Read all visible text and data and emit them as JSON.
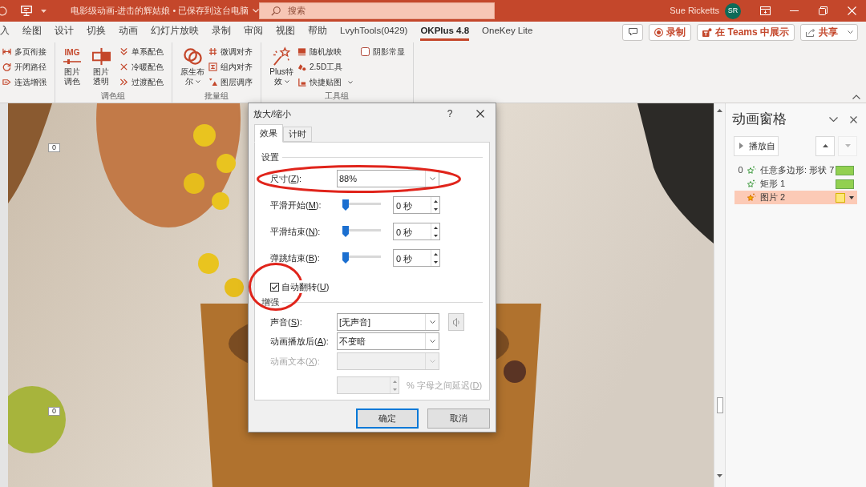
{
  "title_bar": {
    "title": "电影级动画-进击的辉姑娘 • 已保存到这台电脑",
    "user_name": "Sue Ricketts",
    "avatar_initials": "SR"
  },
  "search": {
    "placeholder": "搜索"
  },
  "ribbon_tabs": [
    {
      "label": "入",
      "selected": false
    },
    {
      "label": "绘图",
      "selected": false
    },
    {
      "label": "设计",
      "selected": false
    },
    {
      "label": "切换",
      "selected": false
    },
    {
      "label": "动画",
      "selected": false
    },
    {
      "label": "幻灯片放映",
      "selected": false
    },
    {
      "label": "录制",
      "selected": false
    },
    {
      "label": "审阅",
      "selected": false
    },
    {
      "label": "视图",
      "selected": false
    },
    {
      "label": "帮助",
      "selected": false
    },
    {
      "label": "LvyhTools(0429)",
      "selected": false
    },
    {
      "label": "OKPlus 4.8",
      "selected": true
    },
    {
      "label": "OneKey Lite",
      "selected": false
    }
  ],
  "header_buttons": [
    {
      "kind": "comment"
    },
    {
      "kind": "record",
      "label": "录制"
    },
    {
      "kind": "teams",
      "label": "在 Teams 中展示"
    },
    {
      "kind": "share",
      "label": "共享"
    }
  ],
  "ribbon_groups": [
    {
      "items": [
        {
          "kind": "small",
          "label": "多页衔接"
        },
        {
          "kind": "small",
          "label": "开闭路径"
        },
        {
          "kind": "small",
          "label": "连选增强"
        }
      ]
    },
    {
      "label": "调色组",
      "items": [
        {
          "kind": "large",
          "label": "图片调色",
          "icon_text": "IMG"
        },
        {
          "kind": "large",
          "label": "图片透明"
        },
        {
          "kind": "small",
          "label": "单系配色"
        },
        {
          "kind": "small",
          "label": "冷暖配色"
        },
        {
          "kind": "small",
          "label": "过渡配色"
        }
      ]
    },
    {
      "label": "批量组",
      "items": [
        {
          "kind": "large",
          "label": "原生布尔",
          "dropdown": true
        },
        {
          "kind": "small",
          "label": "微调对齐"
        },
        {
          "kind": "small",
          "label": "组内对齐"
        },
        {
          "kind": "small",
          "label": "图层调序"
        }
      ]
    },
    {
      "label": "工具组",
      "items": [
        {
          "kind": "large",
          "label": "Plus特效",
          "dropdown": true
        },
        {
          "kind": "small",
          "label": "随机放映"
        },
        {
          "kind": "small",
          "label": "2.5D工具"
        },
        {
          "kind": "small",
          "label": "快捷贴图",
          "dropdown": true
        },
        {
          "kind": "checkbox",
          "label": "阴影常显",
          "checked": false
        }
      ]
    }
  ],
  "slide": {
    "order_tags": [
      "0",
      "0"
    ]
  },
  "animation_pane": {
    "title": "动画窗格",
    "play_label": "播放自",
    "move_buttons": [
      {
        "kind": "up",
        "disabled": false
      },
      {
        "kind": "down",
        "disabled": true
      }
    ],
    "items": [
      {
        "order": "0",
        "name": "任意多边形: 形状 7",
        "kind": "entrance",
        "selected": false
      },
      {
        "name": "矩形 1",
        "kind": "entrance",
        "selected": false
      },
      {
        "name": "图片 2",
        "kind": "emphasis",
        "selected": true
      }
    ]
  },
  "dialog": {
    "title": "放大/缩小",
    "help_label": "?",
    "tabs": [
      {
        "label": "效果",
        "selected": true
      },
      {
        "label": "计时",
        "selected": false
      }
    ],
    "sections": [
      {
        "heading": "设置",
        "rows": [
          {
            "kind": "dropdown",
            "label_parts": [
              "尺寸(",
              "Z",
              "):"
            ],
            "value": "88%",
            "disabled": false,
            "circled": true
          },
          {
            "kind": "slider",
            "label_parts": [
              "平滑开始(",
              "M",
              "):"
            ],
            "level": 0,
            "value": "0 秒",
            "disabled": false,
            "circled": false
          },
          {
            "kind": "slider",
            "label_parts": [
              "平滑结束(",
              "N",
              "):"
            ],
            "level": 0,
            "value": "0 秒",
            "disabled": false,
            "circled": false
          },
          {
            "kind": "slider",
            "label_parts": [
              "弹跳结束(",
              "B",
              "):"
            ],
            "level": 0,
            "value": "0 秒",
            "disabled": false,
            "circled": false
          },
          {
            "kind": "checkbox",
            "label_parts": [
              "自动翻转(",
              "U",
              ")"
            ],
            "checked": true,
            "disabled": false,
            "circled": true
          }
        ]
      },
      {
        "heading": "增强",
        "rows": [
          {
            "kind": "sound",
            "label_parts": [
              "声音(",
              "S",
              "):"
            ],
            "value": "[无声音]",
            "disabled": false,
            "circled": false
          },
          {
            "kind": "dropdown",
            "label_parts": [
              "动画播放后(",
              "A",
              "):"
            ],
            "value": "不变暗",
            "disabled": false,
            "circled": false
          },
          {
            "kind": "dropdown",
            "label_parts": [
              "动画文本(",
              "X",
              "):"
            ],
            "disabled": true,
            "circled": false
          },
          {
            "kind": "spinner",
            "suffix_parts": [
              "% 字母之间延迟(",
              "D",
              ")"
            ],
            "disabled": true,
            "circled": false
          }
        ]
      }
    ],
    "buttons": [
      {
        "label": "确定",
        "default": true
      },
      {
        "label": "取消",
        "default": false
      }
    ]
  }
}
